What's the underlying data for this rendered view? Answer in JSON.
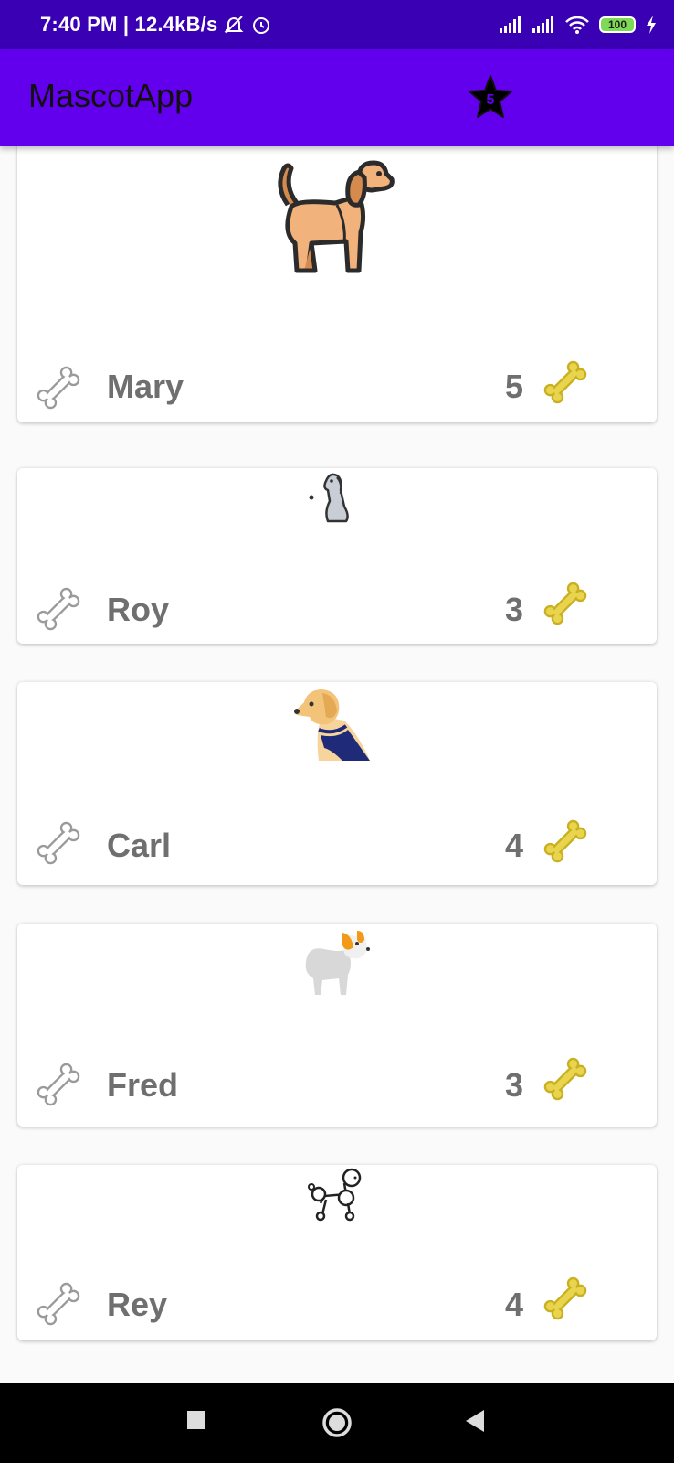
{
  "status": {
    "time_speed": "7:40 PM | 12.4kB/s",
    "battery": "100",
    "icons": [
      "bell-off-icon",
      "alarm-icon",
      "signal-icon",
      "signal-icon",
      "wifi-icon",
      "battery-icon",
      "charging-icon"
    ]
  },
  "app": {
    "title": "MascotApp",
    "favorites_icon": "star-icon",
    "favorites_badge": "5"
  },
  "pets": [
    {
      "name": "Mary",
      "likes": "5",
      "image": "beagle-dog"
    },
    {
      "name": "Roy",
      "likes": "3",
      "image": "sitting-dog"
    },
    {
      "name": "Carl",
      "likes": "4",
      "image": "labrador-dog"
    },
    {
      "name": "Fred",
      "likes": "3",
      "image": "papillon-dog"
    },
    {
      "name": "Rey",
      "likes": "4",
      "image": "poodle-dog"
    }
  ],
  "colors": {
    "status_bar": "#3a00b3",
    "app_bar": "#6200ee",
    "bone_like": "#e8d44d",
    "bone_outline": "#9a9a9a"
  },
  "nav": {
    "icons": [
      "recent-apps-icon",
      "home-icon",
      "back-icon"
    ]
  }
}
